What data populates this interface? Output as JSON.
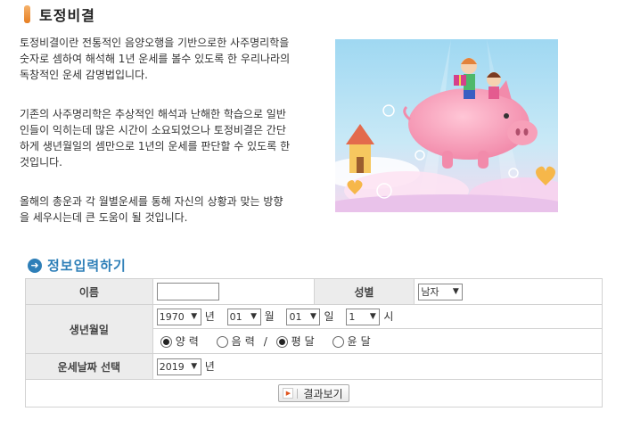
{
  "page": {
    "title": "토정비결"
  },
  "intro": {
    "p1": "토정비결이란 전통적인 음양오행을 기반으로한 사주명리학을 숫자로 셈하여 해석해 1년 운세를 볼수 있도록 한 우리나라의 독창적인 운세 감명법입니다.",
    "p2": "기존의 사주명리학은 추상적인 해석과 난해한 학습으로 일반인들이 익히는데 많은 시간이 소요되었으나 토정비결은 간단하게 생년월일의 셈만으로 1년의 운세를 판단할 수 있도록 한 것입니다.",
    "p3": "올해의 총운과 각 월별운세를 통해 자신의 상황과 맞는 방향을 세우시는데 큰 도움이 될 것입니다."
  },
  "form": {
    "section_title": "정보입력하기",
    "name_label": "이름",
    "name_value": "",
    "gender_label": "성별",
    "gender_value": "남자",
    "birth_label": "생년월일",
    "year_value": "1970",
    "year_unit": "년",
    "month_value": "01",
    "month_unit": "월",
    "day_value": "01",
    "day_unit": "일",
    "hour_value": "1",
    "hour_unit": "시",
    "calendar_options": [
      "양력",
      "음력",
      "평달",
      "윤달"
    ],
    "calendar_selected": "양력",
    "month_type_selected": "평달",
    "separator": "/",
    "fortune_year_label": "운세날짜 선택",
    "fortune_year_value": "2019",
    "fortune_year_unit": "년",
    "submit_label": "결과보기"
  }
}
